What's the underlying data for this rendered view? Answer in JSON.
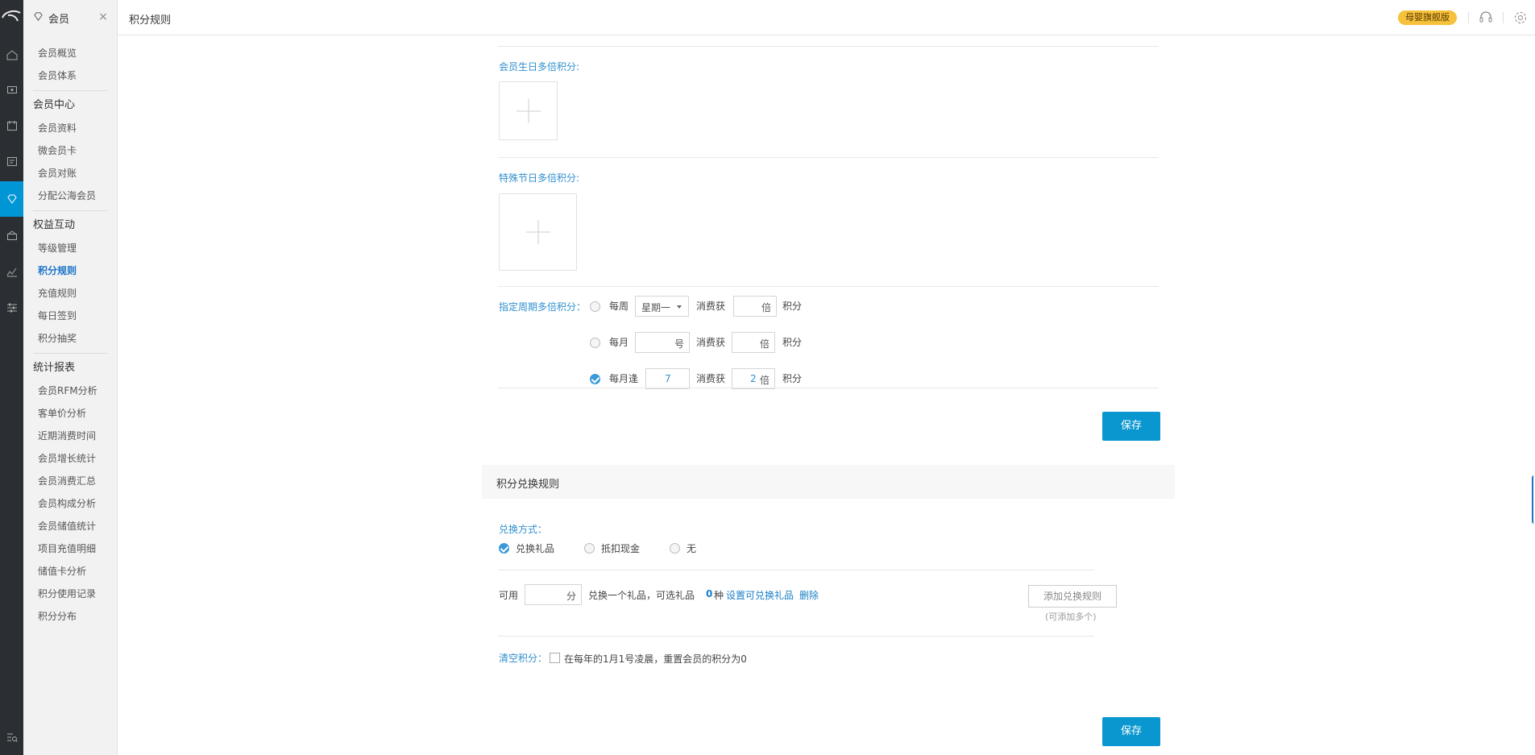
{
  "sidebar": {
    "title": "会员",
    "groups": [
      {
        "items": [
          "会员概览",
          "会员体系"
        ]
      },
      {
        "label": "会员中心",
        "items": [
          "会员资料",
          "微会员卡",
          "会员对账",
          "分配公海会员"
        ]
      },
      {
        "label": "权益互动",
        "items": [
          "等级管理",
          "积分规则",
          "充值规则",
          "每日签到",
          "积分抽奖"
        ]
      },
      {
        "label": "统计报表",
        "items": [
          "会员RFM分析",
          "客单价分析",
          "近期消费时间",
          "会员增长统计",
          "会员消费汇总",
          "会员构成分析",
          "会员储值统计",
          "项目充值明细",
          "储值卡分析",
          "积分使用记录",
          "积分分布"
        ]
      }
    ],
    "active_item": "积分规则"
  },
  "header": {
    "page_title": "积分规则",
    "edition_badge": "母婴旗舰版"
  },
  "birthday": {
    "label": "会员生日多倍积分:"
  },
  "holiday": {
    "label": "特殊节日多倍积分:"
  },
  "period": {
    "label": "指定周期多倍积分：",
    "weekly": {
      "prefix": "每周",
      "select_value": "星期一",
      "mid": "消费获",
      "multiplier": "",
      "unit": "倍",
      "suffix": "积分",
      "checked": false
    },
    "monthly": {
      "prefix": "每月",
      "day": "",
      "day_unit": "号",
      "mid": "消费获",
      "multiplier": "",
      "unit": "倍",
      "suffix": "积分",
      "checked": false
    },
    "monthly_repeat": {
      "prefix": "每月逢",
      "day": "7",
      "mid": "消费获",
      "multiplier": "2",
      "unit": "倍",
      "suffix": "积分",
      "checked": true
    }
  },
  "save_label": "保存",
  "exchange": {
    "section_title": "积分兑换规则",
    "method_label": "兑换方式：",
    "options": [
      {
        "label": "兑换礼品",
        "checked": true
      },
      {
        "label": "抵扣现金",
        "checked": false
      },
      {
        "label": "无",
        "checked": false
      }
    ],
    "rule": {
      "prefix": "可用",
      "points": "",
      "points_unit": "分",
      "text": "兑换一个礼品，可选礼品",
      "count": "0",
      "count_unit": "种",
      "set_link": "设置可兑换礼品",
      "delete_link": "删除"
    },
    "add_rule_label": "添加兑换规则",
    "add_rule_hint": "(可添加多个)"
  },
  "clear": {
    "label": "清空积分：",
    "text": "在每年的1月1号凌晨，重置会员的积分为0"
  }
}
